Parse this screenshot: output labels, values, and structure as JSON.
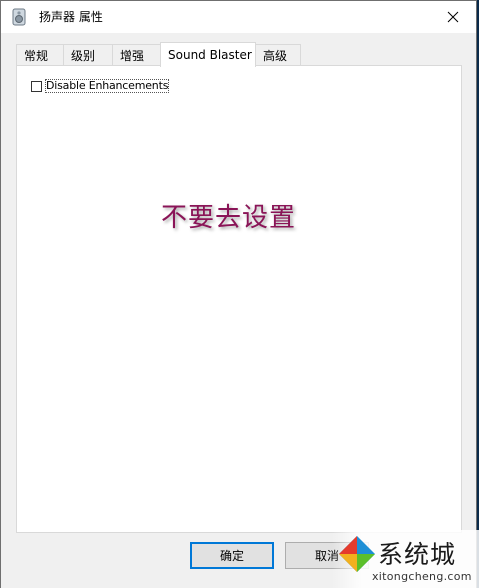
{
  "window": {
    "title": "扬声器 属性"
  },
  "tabs": [
    {
      "label": "常规"
    },
    {
      "label": "级别"
    },
    {
      "label": "增强"
    },
    {
      "label": "Sound Blaster",
      "active": true
    },
    {
      "label": "高级"
    }
  ],
  "panel": {
    "checkbox_label": "Disable Enhancements",
    "checked": false
  },
  "annotation": "不要去设置",
  "buttons": {
    "ok": "确定",
    "cancel": "取消"
  },
  "watermark": {
    "brand": "系统城",
    "url": "xitongcheng.com"
  },
  "colors": {
    "annotation": "#8a1457",
    "accent": "#0078d7",
    "watermark_blue": "#1e8fd6",
    "watermark_green": "#5bbf2a"
  }
}
